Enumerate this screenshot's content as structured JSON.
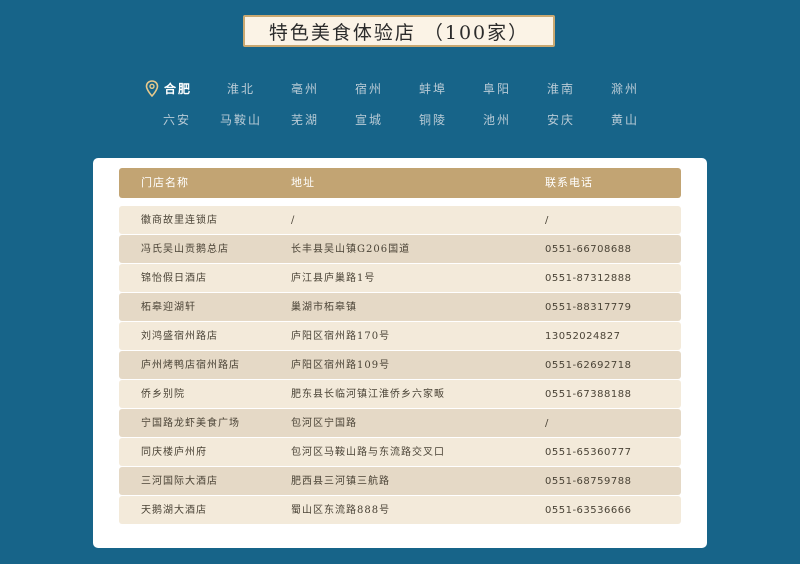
{
  "page": {
    "title": "特色美食体验店 （100家）"
  },
  "cities": {
    "row1": [
      "合肥",
      "淮北",
      "亳州",
      "宿州",
      "蚌埠",
      "阜阳",
      "淮南",
      "滁州"
    ],
    "row2": [
      "六安",
      "马鞍山",
      "芜湖",
      "宣城",
      "铜陵",
      "池州",
      "安庆",
      "黄山"
    ],
    "active": "合肥"
  },
  "table": {
    "headers": [
      "门店名称",
      "地址",
      "联系电话"
    ],
    "rows": [
      [
        "徽商故里连锁店",
        "/",
        "/"
      ],
      [
        "冯氏吴山贡鹅总店",
        "长丰县吴山镇G206国道",
        "0551-66708688"
      ],
      [
        "锦怡假日酒店",
        "庐江县庐巢路1号",
        "0551-87312888"
      ],
      [
        "柘皋迎湖轩",
        "巢湖市柘皋镇",
        "0551-88317779"
      ],
      [
        "刘鸿盛宿州路店",
        "庐阳区宿州路170号",
        "13052024827"
      ],
      [
        "庐州烤鸭店宿州路店",
        "庐阳区宿州路109号",
        "0551-62692718"
      ],
      [
        "侨乡别院",
        "肥东县长临河镇江淮侨乡六家畈",
        "0551-67388188"
      ],
      [
        "宁国路龙虾美食广场",
        "包河区宁国路",
        "/"
      ],
      [
        "同庆楼庐州府",
        "包河区马鞍山路与东流路交叉口",
        "0551-65360777"
      ],
      [
        "三河国际大酒店",
        "肥西县三河镇三航路",
        "0551-68759788"
      ],
      [
        "天鹅湖大酒店",
        "蜀山区东流路888号",
        "0551-63536666"
      ]
    ]
  },
  "colors": {
    "background": "#176489",
    "header": "#c2a473",
    "row_light": "#f3eada",
    "row_dark": "#e5d9c6"
  },
  "icons": {
    "location": "map-pin-icon"
  }
}
